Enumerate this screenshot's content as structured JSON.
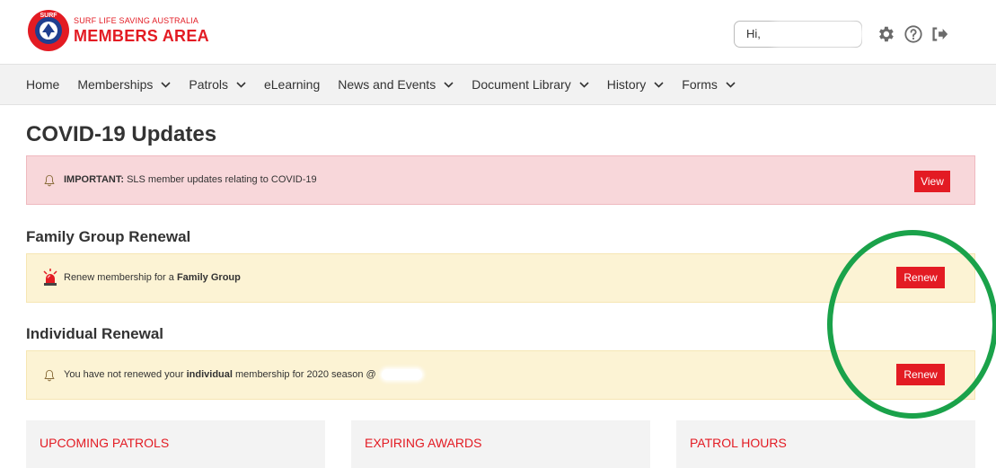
{
  "header": {
    "brand_top": "SURF LIFE SAVING AUSTRALIA",
    "brand_main": "MEMBERS AREA",
    "greeting": "Hi,",
    "icons": [
      "gear-icon",
      "help-icon",
      "logout-icon"
    ]
  },
  "nav": {
    "items": [
      {
        "label": "Home",
        "dropdown": false
      },
      {
        "label": "Memberships",
        "dropdown": true
      },
      {
        "label": "Patrols",
        "dropdown": true
      },
      {
        "label": "eLearning",
        "dropdown": false
      },
      {
        "label": "News and Events",
        "dropdown": true
      },
      {
        "label": "Document Library",
        "dropdown": true
      },
      {
        "label": "History",
        "dropdown": true
      },
      {
        "label": "Forms",
        "dropdown": true
      }
    ]
  },
  "main": {
    "page_title": "COVID-19 Updates",
    "covid_alert": {
      "strong": "IMPORTANT:",
      "text": " SLS member updates relating to COVID-19",
      "button": "View"
    },
    "family": {
      "title": "Family Group Renewal",
      "text_pre": "Renew membership for a ",
      "text_strong": "Family Group",
      "button": "Renew"
    },
    "individual": {
      "title": "Individual Renewal",
      "text_pre": "You have not renewed your ",
      "text_strong": "individual",
      "text_post": " membership for 2020 season @",
      "button": "Renew"
    },
    "cards": [
      {
        "title": "UPCOMING PATROLS"
      },
      {
        "title": "EXPIRING AWARDS"
      },
      {
        "title": "PATROL HOURS"
      }
    ]
  },
  "colors": {
    "brand_red": "#e31b23",
    "alert_red_bg": "#f8d7da",
    "alert_yellow_bg": "#fcf3d4",
    "annotation_green": "#1aa24a"
  }
}
